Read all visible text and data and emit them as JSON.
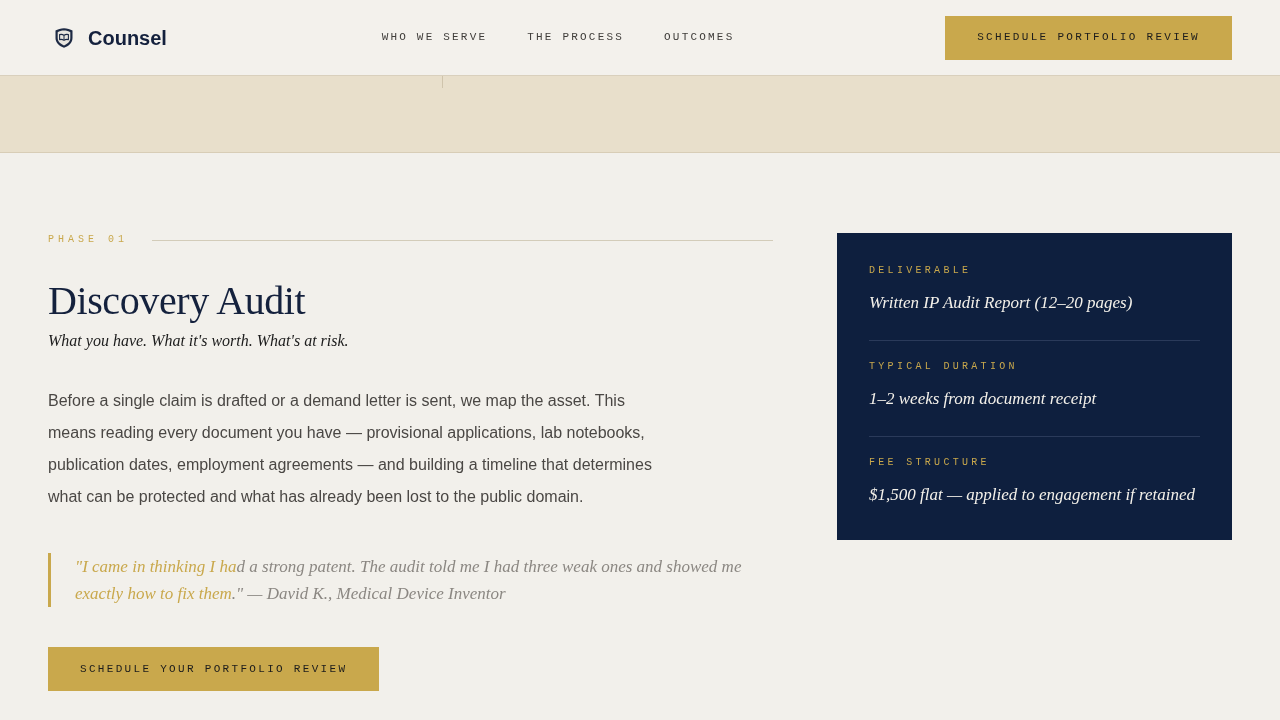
{
  "header": {
    "logo": {
      "name": "Counsel"
    },
    "nav": [
      "WHO WE SERVE",
      "THE PROCESS",
      "OUTCOMES"
    ],
    "cta": "SCHEDULE PORTFOLIO REVIEW"
  },
  "phase": {
    "label": "PHASE 01",
    "title": "Discovery Audit",
    "subtitle": "What you have. What it's worth. What's at risk.",
    "body": "Before a single claim is drafted or a demand letter is sent, we map the asset. This means reading every document you have — provisional applications, lab notebooks, publication dates, employment agreements — and building a timeline that determines what can be protected and what has already been lost to the public domain.",
    "quote": [
      {
        "text": "\"I came in thinking I ha",
        "highlighted": true
      },
      {
        "text": "d a strong patent. The audit told me I had three weak ones and showed me ",
        "highlighted": false
      },
      {
        "text": "exactly how to fix them",
        "highlighted": true
      },
      {
        "text": ".\" — David K., Medical Device Inventor",
        "highlighted": false
      }
    ],
    "cta": "SCHEDULE YOUR PORTFOLIO REVIEW"
  },
  "details": [
    {
      "label": "DELIVERABLE",
      "value": "Written IP Audit Report (12–20 pages)"
    },
    {
      "label": "TYPICAL DURATION",
      "value": "1–2 weeks from document receipt"
    },
    {
      "label": "FEE STRUCTURE",
      "value": "$1,500 flat — applied to engagement if retained"
    }
  ]
}
